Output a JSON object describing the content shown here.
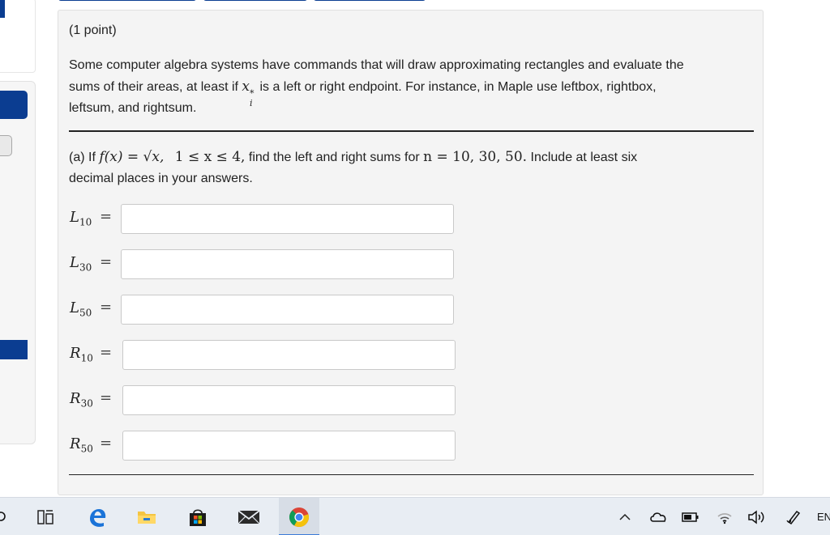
{
  "problem": {
    "points": "(1 point)",
    "intro_line1": "Some computer algebra systems have commands that will draw approximating rectangles and evaluate the",
    "intro_line2_pre": "sums of their areas, at least if ",
    "intro_var": "x",
    "intro_sub": "i",
    "intro_sup": "*",
    "intro_line2_post": " is a left or right endpoint. For instance, in Maple use leftbox, rightbox,",
    "intro_line3": "leftsum, and rightsum.",
    "part_a_prefix": "(a) If ",
    "part_a_func": "f(x) = √x,",
    "part_a_domain": "1 ≤ x ≤ 4,",
    "part_a_mid": " find the left and right sums for ",
    "part_a_n": "n = 10, 30, 50.",
    "part_a_suffix": " Include at least six",
    "part_a_line2": "decimal places in your answers.",
    "answers": [
      {
        "letter": "L",
        "sub": "10",
        "eq": "=",
        "value": ""
      },
      {
        "letter": "L",
        "sub": "30",
        "eq": "=",
        "value": ""
      },
      {
        "letter": "L",
        "sub": "50",
        "eq": "=",
        "value": ""
      },
      {
        "letter": "R",
        "sub": "10",
        "eq": "=",
        "value": ""
      },
      {
        "letter": "R",
        "sub": "30",
        "eq": "=",
        "value": ""
      },
      {
        "letter": "R",
        "sub": "50",
        "eq": "=",
        "value": ""
      }
    ]
  },
  "taskbar": {
    "language": "EN",
    "icons": [
      "search-icon",
      "task-view-icon",
      "edge-icon",
      "file-explorer-icon",
      "store-icon",
      "mail-icon",
      "chrome-icon",
      "chevron-up-icon",
      "onedrive-icon",
      "battery-icon",
      "wifi-icon",
      "volume-icon",
      "pen-icon"
    ]
  },
  "colors": {
    "accent": "#0b3d91",
    "card_bg": "#f4f4f4",
    "taskbar_bg": "#e8edf3"
  }
}
